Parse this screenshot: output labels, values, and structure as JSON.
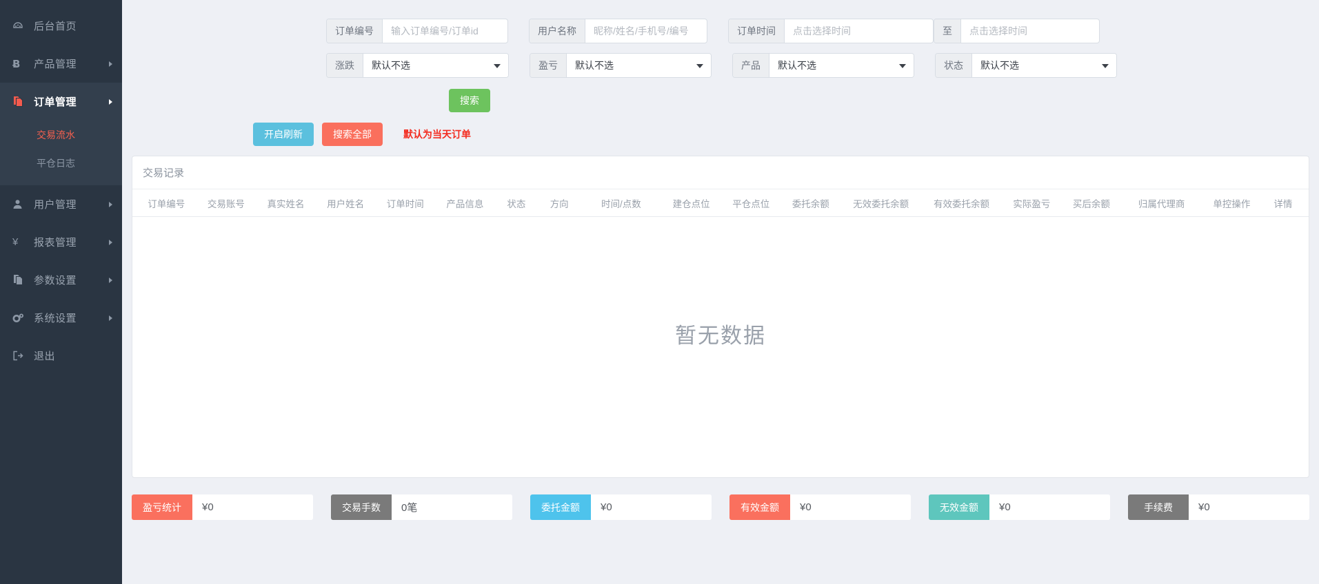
{
  "sidebar": {
    "items": [
      {
        "label": "后台首页",
        "icon": "dashboard-icon",
        "glyph": "⛁",
        "has_caret": false,
        "active": false
      },
      {
        "label": "产品管理",
        "icon": "bitcoin-icon",
        "glyph": "Ƀ",
        "has_caret": true,
        "active": false
      },
      {
        "label": "订单管理",
        "icon": "order-file-icon",
        "glyph": "❐",
        "has_caret": true,
        "active": true
      },
      {
        "label": "用户管理",
        "icon": "user-icon",
        "glyph": "♟",
        "has_caret": true,
        "active": false
      },
      {
        "label": "报表管理",
        "icon": "yen-icon",
        "glyph": "¥",
        "has_caret": true,
        "active": false
      },
      {
        "label": "参数设置",
        "icon": "copy-icon",
        "glyph": "❐",
        "has_caret": true,
        "active": false
      },
      {
        "label": "系统设置",
        "icon": "gears-icon",
        "glyph": "⚙",
        "has_caret": true,
        "active": false
      },
      {
        "label": "退出",
        "icon": "logout-icon",
        "glyph": "→",
        "has_caret": false,
        "active": false
      }
    ],
    "submenu": [
      {
        "label": "交易流水",
        "active": true
      },
      {
        "label": "平仓日志",
        "active": false
      }
    ]
  },
  "filters": {
    "order_no": {
      "label": "订单编号",
      "placeholder": "输入订单编号/订单id",
      "value": ""
    },
    "user_name": {
      "label": "用户名称",
      "placeholder": "昵称/姓名/手机号/编号",
      "value": ""
    },
    "order_time_start": {
      "label": "订单时间",
      "placeholder": "点击选择时间",
      "value": ""
    },
    "order_time_end": {
      "label": "至",
      "placeholder": "点击选择时间",
      "value": ""
    },
    "updown": {
      "label": "涨跌",
      "value": "默认不选",
      "options": [
        "默认不选"
      ]
    },
    "profit_loss": {
      "label": "盈亏",
      "value": "默认不选",
      "options": [
        "默认不选"
      ]
    },
    "product": {
      "label": "产品",
      "value": "默认不选",
      "options": [
        "默认不选"
      ]
    },
    "status": {
      "label": "状态",
      "value": "默认不选",
      "options": [
        "默认不选"
      ]
    }
  },
  "buttons": {
    "search": "搜索",
    "refresh": "开启刷新",
    "search_all": "搜索全部"
  },
  "hint": "默认为当天订单",
  "table": {
    "title": "交易记录",
    "columns": [
      "订单编号",
      "交易账号",
      "真实姓名",
      "用户姓名",
      "订单时间",
      "产品信息",
      "状态",
      "方向",
      "时间/点数",
      "建仓点位",
      "平仓点位",
      "委托余额",
      "无效委托余额",
      "有效委托余额",
      "实际盈亏",
      "买后余额",
      "归属代理商",
      "单控操作",
      "详情"
    ],
    "empty_text": "暂无数据",
    "rows": []
  },
  "summary": [
    {
      "label": "盈亏统计",
      "value": "¥0",
      "color": "#fa705e"
    },
    {
      "label": "交易手数",
      "value": "0笔",
      "color": "#7a7a7a"
    },
    {
      "label": "委托金额",
      "value": "¥0",
      "color": "#4ec3ec"
    },
    {
      "label": "有效金额",
      "value": "¥0",
      "color": "#fa705e"
    },
    {
      "label": "无效金额",
      "value": "¥0",
      "color": "#5ec6bd"
    },
    {
      "label": "手续费",
      "value": "¥0",
      "color": "#7a7a7a"
    }
  ],
  "colors": {
    "sidebar_bg": "#2a3542",
    "sidebar_active_bg": "#333f4d",
    "accent_red": "#f4604f",
    "page_bg": "#eef0f5",
    "green": "#6dc35e",
    "blue": "#5bc0de"
  }
}
